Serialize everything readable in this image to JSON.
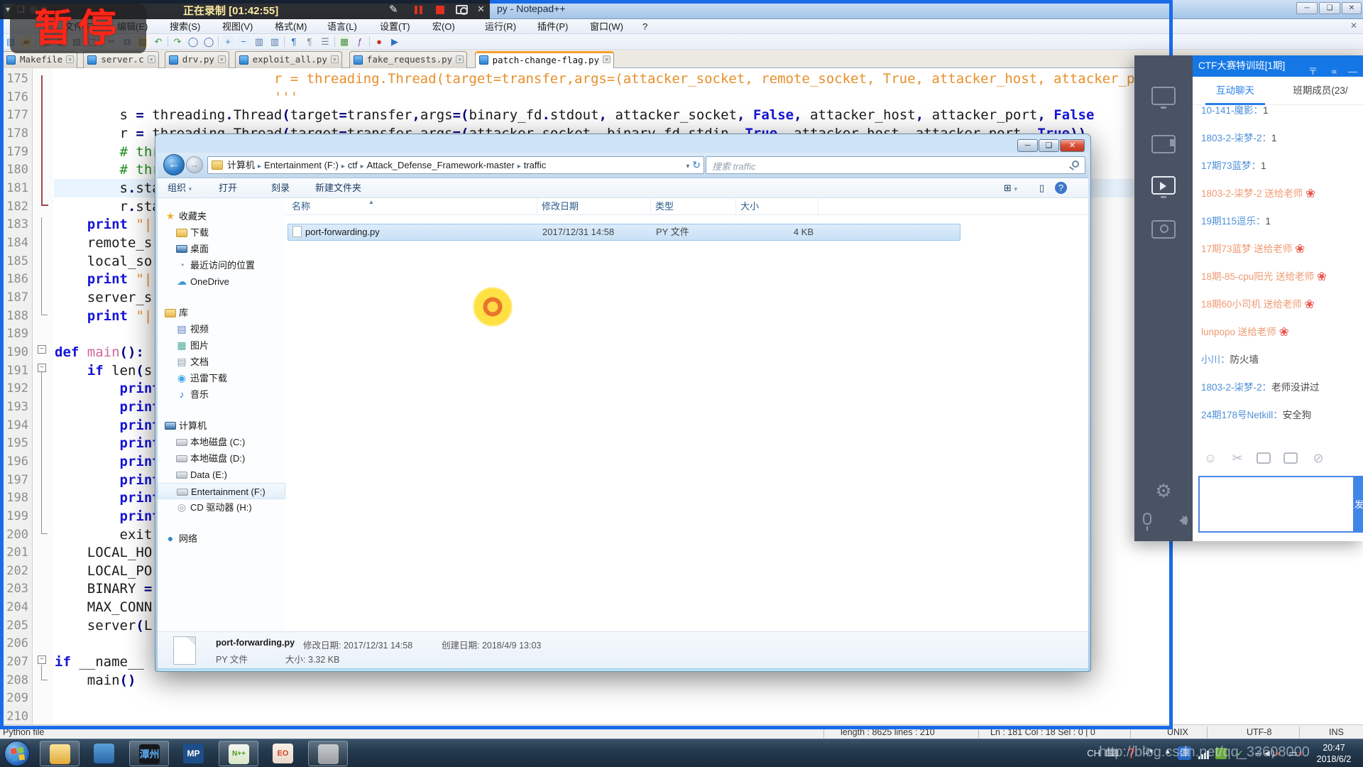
{
  "recording": {
    "timer": "正在录制 [01:42:55]",
    "stamp": "暂停"
  },
  "notepad": {
    "title": "py - Notepad++",
    "menus": [
      "文件(F)",
      "编辑(E)",
      "搜索(S)",
      "视图(V)",
      "格式(M)",
      "语言(L)",
      "设置(T)",
      "宏(O)",
      "运行(R)",
      "插件(P)",
      "窗口(W)",
      "?"
    ],
    "tabs": [
      {
        "label": "Makefile",
        "active": false
      },
      {
        "label": "server.c",
        "active": false
      },
      {
        "label": "drv.py",
        "active": false
      },
      {
        "label": "exploit_all.py",
        "active": false
      },
      {
        "label": "fake_requests.py",
        "active": false
      },
      {
        "label": "patch-change-flag.py",
        "active": true
      }
    ],
    "toolbar_icons": [
      "new-file",
      "open-file",
      "save",
      "save-all",
      "print",
      "close",
      "cut",
      "copy",
      "paste",
      "undo",
      "redo",
      "find",
      "replace",
      "zoom-in",
      "zoom-out",
      "sync-v",
      "sync-h",
      "word-wrap",
      "show-symbols",
      "indent-guide",
      "doc-map",
      "function-list",
      "record-macro",
      "play-macro"
    ],
    "code_lines": [
      {
        "n": 175,
        "s": [
          [
            "str",
            "                           r = threading.Thread(target=transfer,args=(attacker_socket, remote_socket, True, attacker_host, attacker_port, True)) #"
          ]
        ]
      },
      {
        "n": 176,
        "s": [
          [
            "str",
            "                           '''"
          ]
        ]
      },
      {
        "n": 177,
        "s": [
          [
            "pln",
            "        s "
          ],
          [
            "opr",
            "= "
          ],
          [
            "pln",
            "threading"
          ],
          [
            "opr",
            "."
          ],
          [
            "pln",
            "Thread"
          ],
          [
            "opr",
            "("
          ],
          [
            "pln",
            "target"
          ],
          [
            "opr",
            "="
          ],
          [
            "pln",
            "transfer"
          ],
          [
            "opr",
            ","
          ],
          [
            "pln",
            "args"
          ],
          [
            "opr",
            "=("
          ],
          [
            "pln",
            "binary_fd"
          ],
          [
            "opr",
            "."
          ],
          [
            "pln",
            "stdout"
          ],
          [
            "opr",
            ", "
          ],
          [
            "pln",
            "attacker_socket"
          ],
          [
            "opr",
            ", "
          ],
          [
            "kwd",
            "False"
          ],
          [
            "opr",
            ", "
          ],
          [
            "pln",
            "attacker_host"
          ],
          [
            "opr",
            ", "
          ],
          [
            "pln",
            "attacker_port"
          ],
          [
            "opr",
            ", "
          ],
          [
            "kwd",
            "False"
          ]
        ]
      },
      {
        "n": 178,
        "s": [
          [
            "pln",
            "        r "
          ],
          [
            "opr",
            "= "
          ],
          [
            "pln",
            "threading"
          ],
          [
            "opr",
            "."
          ],
          [
            "pln",
            "Thread"
          ],
          [
            "opr",
            "("
          ],
          [
            "pln",
            "target"
          ],
          [
            "opr",
            "="
          ],
          [
            "pln",
            "transfer"
          ],
          [
            "opr",
            ","
          ],
          [
            "pln",
            "args"
          ],
          [
            "opr",
            "=("
          ],
          [
            "pln",
            "attacker_socket"
          ],
          [
            "opr",
            ", "
          ],
          [
            "pln",
            "binary_fd"
          ],
          [
            "opr",
            "."
          ],
          [
            "pln",
            "stdin"
          ],
          [
            "opr",
            ", "
          ],
          [
            "kwd",
            "True"
          ],
          [
            "opr",
            ", "
          ],
          [
            "pln",
            "attacker_host"
          ],
          [
            "opr",
            ", "
          ],
          [
            "pln",
            "attacker_port"
          ],
          [
            "opr",
            ", "
          ],
          [
            "kwd",
            "True"
          ],
          [
            "opr",
            "))"
          ]
        ]
      },
      {
        "n": 179,
        "s": [
          [
            "com",
            "        # thread"
          ]
        ]
      },
      {
        "n": 180,
        "s": [
          [
            "com",
            "        # thread"
          ]
        ]
      },
      {
        "n": 181,
        "s": [
          [
            "pln",
            "        s"
          ],
          [
            "opr",
            "."
          ],
          [
            "pln",
            "start()"
          ]
        ],
        "cur": true
      },
      {
        "n": 182,
        "s": [
          [
            "pln",
            "        r"
          ],
          [
            "opr",
            "."
          ],
          [
            "pln",
            "start()"
          ]
        ]
      },
      {
        "n": 183,
        "s": [
          [
            "kwd",
            "    print "
          ],
          [
            "str",
            "\"|"
          ]
        ]
      },
      {
        "n": 184,
        "s": [
          [
            "pln",
            "    remote_s"
          ]
        ]
      },
      {
        "n": 185,
        "s": [
          [
            "pln",
            "    local_so"
          ]
        ]
      },
      {
        "n": 186,
        "s": [
          [
            "kwd",
            "    print "
          ],
          [
            "str",
            "\"|"
          ]
        ]
      },
      {
        "n": 187,
        "s": [
          [
            "pln",
            "    server_s"
          ]
        ]
      },
      {
        "n": 188,
        "s": [
          [
            "kwd",
            "    print "
          ],
          [
            "str",
            "\"|"
          ]
        ]
      },
      {
        "n": 189,
        "s": []
      },
      {
        "n": 190,
        "s": [
          [
            "kwd",
            "def "
          ],
          [
            "fnc",
            "main"
          ],
          [
            "opr",
            "():"
          ]
        ]
      },
      {
        "n": 191,
        "s": [
          [
            "kwd",
            "    if "
          ],
          [
            "pln",
            "len"
          ],
          [
            "opr",
            "("
          ],
          [
            "pln",
            "s"
          ]
        ]
      },
      {
        "n": 192,
        "s": [
          [
            "kwd",
            "        print"
          ]
        ]
      },
      {
        "n": 193,
        "s": [
          [
            "kwd",
            "        print"
          ]
        ]
      },
      {
        "n": 194,
        "s": [
          [
            "kwd",
            "        print"
          ]
        ]
      },
      {
        "n": 195,
        "s": [
          [
            "kwd",
            "        print"
          ]
        ]
      },
      {
        "n": 196,
        "s": [
          [
            "kwd",
            "        print"
          ]
        ]
      },
      {
        "n": 197,
        "s": [
          [
            "kwd",
            "        print"
          ]
        ]
      },
      {
        "n": 198,
        "s": [
          [
            "kwd",
            "        print"
          ]
        ]
      },
      {
        "n": 199,
        "s": [
          [
            "kwd",
            "        print"
          ]
        ]
      },
      {
        "n": 200,
        "s": [
          [
            "pln",
            "        exit"
          ]
        ]
      },
      {
        "n": 201,
        "s": [
          [
            "pln",
            "    LOCAL_HO"
          ]
        ]
      },
      {
        "n": 202,
        "s": [
          [
            "pln",
            "    LOCAL_PO"
          ]
        ]
      },
      {
        "n": 203,
        "s": [
          [
            "pln",
            "    BINARY "
          ],
          [
            "opr",
            "="
          ]
        ]
      },
      {
        "n": 204,
        "s": [
          [
            "pln",
            "    MAX_CONN"
          ]
        ]
      },
      {
        "n": 205,
        "s": [
          [
            "pln",
            "    server"
          ],
          [
            "opr",
            "("
          ],
          [
            "pln",
            "L"
          ]
        ]
      },
      {
        "n": 206,
        "s": []
      },
      {
        "n": 207,
        "s": [
          [
            "kwd",
            "if "
          ],
          [
            "pln",
            "__name__"
          ]
        ]
      },
      {
        "n": 208,
        "s": [
          [
            "pln",
            "    main"
          ],
          [
            "opr",
            "()"
          ]
        ]
      },
      {
        "n": 209,
        "s": []
      },
      {
        "n": 210,
        "s": []
      }
    ],
    "status": {
      "doctype": "Python file",
      "length": "length : 8625    lines : 210",
      "position": "Ln : 181    Col : 18    Sel : 0 | 0",
      "eol": "UNIX",
      "encoding": "UTF-8",
      "insert": "INS"
    }
  },
  "explorer": {
    "breadcrumb": [
      "计算机",
      "Entertainment (F:)",
      "ctf",
      "Attack_Defense_Framework-master",
      "traffic"
    ],
    "search_placeholder": "搜索 traffic",
    "toolbar": [
      "组织",
      "打开",
      "刻录",
      "新建文件夹"
    ],
    "columns": [
      "名称",
      "修改日期",
      "类型",
      "大小"
    ],
    "file": {
      "name": "port-forwarding.py",
      "modified": "2017/12/31 14:58",
      "type": "PY 文件",
      "size": "4 KB"
    },
    "sidebar": [
      {
        "header": "收藏夹",
        "icon": "favorites-star-icon",
        "items": [
          {
            "label": "下载",
            "icon": "download-folder-icon"
          },
          {
            "label": "桌面",
            "icon": "desktop-icon"
          },
          {
            "label": "最近访问的位置",
            "icon": "recent-places-icon"
          },
          {
            "label": "OneDrive",
            "icon": "onedrive-icon"
          }
        ]
      },
      {
        "header": "库",
        "icon": "libraries-icon",
        "items": [
          {
            "label": "视频",
            "icon": "videos-icon"
          },
          {
            "label": "图片",
            "icon": "pictures-icon"
          },
          {
            "label": "文档",
            "icon": "documents-icon"
          },
          {
            "label": "迅雷下载",
            "icon": "thunder-download-icon"
          },
          {
            "label": "音乐",
            "icon": "music-icon"
          }
        ]
      },
      {
        "header": "计算机",
        "icon": "computer-icon",
        "items": [
          {
            "label": "本地磁盘 (C:)",
            "icon": "drive-icon"
          },
          {
            "label": "本地磁盘 (D:)",
            "icon": "drive-icon"
          },
          {
            "label": "Data (E:)",
            "icon": "drive-icon"
          },
          {
            "label": "Entertainment (F:)",
            "icon": "drive-icon",
            "highlight": true
          },
          {
            "label": "CD 驱动器 (H:)",
            "icon": "cd-drive-icon"
          }
        ]
      },
      {
        "header": "网络",
        "icon": "network-icon",
        "items": []
      }
    ],
    "details": {
      "name": "port-forwarding.py",
      "type": "PY 文件",
      "modified_label": "修改日期: 2017/12/31 14:58",
      "created_label": "创建日期: 2018/4/9 13:03",
      "size_label": "大小: 3.32 KB"
    }
  },
  "chat": {
    "title": "CTF大赛特训班[1期]",
    "tabs": [
      "互动聊天",
      "班期成员(23/"
    ],
    "messages": [
      {
        "name": "10-141-魔影",
        "text": "1"
      },
      {
        "name": "1803-2-柒梦-2",
        "text": "1"
      },
      {
        "name": "17期73蓝梦",
        "text": "1"
      },
      {
        "gift": "1803-2-柒梦-2 送给老师"
      },
      {
        "name": "19期115逗乐",
        "text": "1"
      },
      {
        "gift": "17期73蓝梦 送给老师"
      },
      {
        "gift": "18期-85-cpu阳光 送给老师"
      },
      {
        "gift": "18期60小司机 送给老师"
      },
      {
        "gift": "lunpopo 送给老师"
      },
      {
        "name": "小川",
        "text": "防火墙"
      },
      {
        "name": "1803-2-柒梦-2",
        "text": "老师没讲过"
      },
      {
        "name": "24期178号Netkill",
        "text": "安全狗"
      }
    ],
    "send_label": "发"
  },
  "taskbar": {
    "apps": [
      {
        "name": "windows-explorer",
        "label": "",
        "open": true
      },
      {
        "name": "vmware",
        "label": "",
        "open": false
      },
      {
        "name": "tanzhou-app",
        "label": "潭州",
        "open": true
      },
      {
        "name": "mp-app",
        "label": "MP",
        "open": false
      },
      {
        "name": "notepad-plus-plus",
        "label": "N++",
        "open": true
      },
      {
        "name": "powerpoint",
        "label": "EO",
        "open": false
      },
      {
        "name": "screen-recorder",
        "label": "",
        "open": true
      }
    ],
    "tray": {
      "lang": "CH",
      "clock_time": "20:47",
      "clock_date": "2018/6/2"
    },
    "watermark": "http://blog.csdn.net/qq_33608000"
  }
}
